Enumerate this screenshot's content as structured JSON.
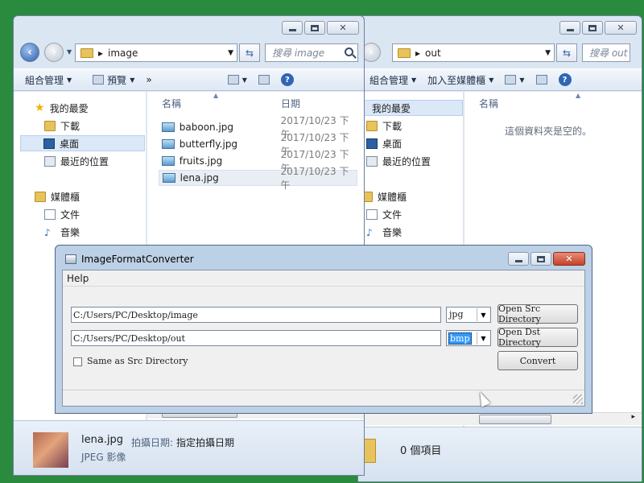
{
  "left_window": {
    "address": "image",
    "search_placeholder": "搜尋 image",
    "toolbar": {
      "organize": "組合管理",
      "preview": "預覽",
      "more": "»"
    },
    "nav": {
      "favorites": "我的最愛",
      "downloads": "下載",
      "desktop": "桌面",
      "recent": "最近的位置",
      "libraries": "媒體櫃",
      "documents": "文件",
      "music": "音樂"
    },
    "columns": {
      "name": "名稱",
      "date": "日期"
    },
    "files": [
      {
        "name": "baboon.jpg",
        "date": "2017/10/23 下午"
      },
      {
        "name": "butterfly.jpg",
        "date": "2017/10/23 下午"
      },
      {
        "name": "fruits.jpg",
        "date": "2017/10/23 下午"
      },
      {
        "name": "lena.jpg",
        "date": "2017/10/23 下午"
      }
    ],
    "details": {
      "filename": "lena.jpg",
      "type": "JPEG 影像",
      "date_label": "拍攝日期:",
      "date_value": "指定拍攝日期"
    }
  },
  "right_window": {
    "address": "out",
    "search_placeholder": "搜尋 out",
    "toolbar": {
      "organize": "組合管理",
      "add_to_library": "加入至媒體櫃"
    },
    "nav": {
      "favorites": "我的最愛",
      "downloads": "下載",
      "desktop": "桌面",
      "recent": "最近的位置",
      "libraries": "媒體櫃",
      "documents": "文件",
      "music": "音樂"
    },
    "columns": {
      "name": "名稱"
    },
    "empty_message": "這個資料夾是空的。",
    "details": {
      "count": "0 個項目"
    }
  },
  "app": {
    "title": "ImageFormatConverter",
    "menu": {
      "help": "Help"
    },
    "src_path": "C:/Users/PC/Desktop/image",
    "src_format": "jpg",
    "dst_path": "C:/Users/PC/Desktop/out",
    "dst_format": "bmp",
    "open_src_label": "Open Src Directory",
    "open_dst_label": "Open Dst Directory",
    "same_as_src_label": "Same as Src Directory",
    "convert_label": "Convert"
  }
}
